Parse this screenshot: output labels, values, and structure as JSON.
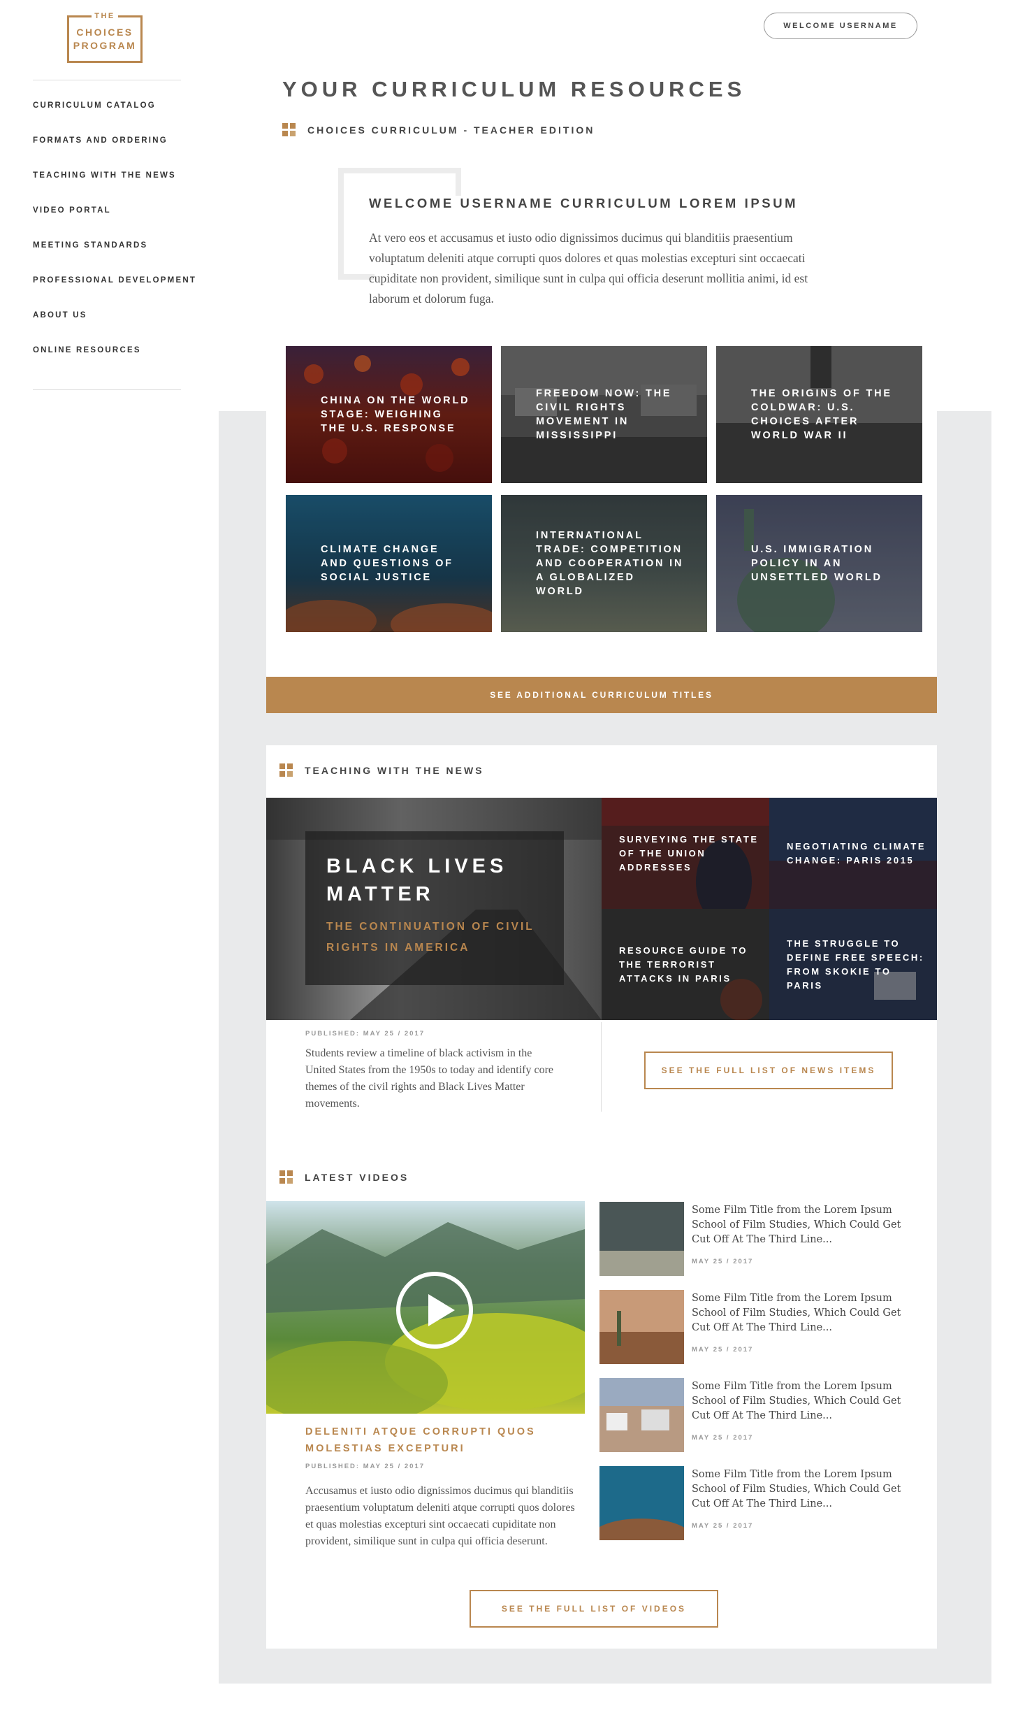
{
  "logo": {
    "line1": "THE",
    "line2": "CHOICES",
    "line3": "PROGRAM"
  },
  "header": {
    "welcome_button": "WELCOME USERNAME"
  },
  "sidebar": {
    "items": [
      {
        "label": "CURRICULUM CATALOG"
      },
      {
        "label": "FORMATS AND ORDERING"
      },
      {
        "label": "TEACHING WITH THE NEWS"
      },
      {
        "label": "VIDEO PORTAL"
      },
      {
        "label": "MEETING STANDARDS"
      },
      {
        "label": "PROFESSIONAL DEVELOPMENT"
      },
      {
        "label": "ABOUT US"
      },
      {
        "label": "ONLINE RESOURCES"
      }
    ]
  },
  "main": {
    "title": "YOUR CURRICULUM RESOURCES",
    "section_label": "CHOICES CURRICULUM - TEACHER EDITION",
    "welcome_heading": "WELCOME USERNAME CURRICULUM LOREM IPSUM",
    "welcome_text": "At vero eos et accusamus et iusto odio dignissimos ducimus qui blanditiis praesentium voluptatum deleniti atque corrupti quos dolores et quas molestias excepturi sint occaecati cupiditate non provident, similique sunt in culpa qui officia deserunt mollitia animi, id est laborum et dolorum fuga.",
    "tiles": [
      {
        "label": "CHINA ON THE WORLD STAGE: WEIGHING THE U.S. RESPONSE"
      },
      {
        "label": "FREEDOM NOW: THE CIVIL RIGHTS MOVEMENT IN MISSISSIPPI"
      },
      {
        "label": "THE ORIGINS OF THE COLDWAR: U.S. CHOICES AFTER WORLD WAR II"
      },
      {
        "label": "CLIMATE CHANGE AND QUESTIONS OF SOCIAL JUSTICE"
      },
      {
        "label": "INTERNATIONAL TRADE: COMPETITION AND COOPERATION IN A GLOBALIZED WORLD"
      },
      {
        "label": "U.S. IMMIGRATION POLICY IN AN UNSETTLED WORLD"
      }
    ],
    "cta_label": "SEE ADDITIONAL CURRICULUM TITLES"
  },
  "news": {
    "section_label": "TEACHING WITH THE NEWS",
    "feature": {
      "title": "BLACK LIVES MATTER",
      "subtitle": "THE CONTINUATION OF CIVIL RIGHTS IN AMERICA",
      "published": "PUBLISHED: MAY 25 / 2017",
      "description": "Students review a timeline of black activism in the United States from the 1950s to today and identify core themes of the civil rights and Black Lives Matter movements."
    },
    "items": [
      {
        "label": "SURVEYING THE STATE OF THE UNION ADDRESSES"
      },
      {
        "label": "NEGOTIATING CLIMATE CHANGE: PARIS 2015"
      },
      {
        "label": "RESOURCE GUIDE TO THE TERRORIST ATTACKS IN PARIS"
      },
      {
        "label": "THE STRUGGLE TO DEFINE FREE SPEECH: FROM SKOKIE TO PARIS"
      }
    ],
    "button_label": "SEE THE FULL LIST OF NEWS ITEMS"
  },
  "videos": {
    "section_label": "LATEST VIDEOS",
    "feature": {
      "title": "DELENITI ATQUE CORRUPTI QUOS MOLESTIAS EXCEPTURI",
      "published": "PUBLISHED: MAY 25 / 2017",
      "description": "Accusamus et iusto odio dignissimos ducimus qui blanditiis praesentium voluptatum deleniti atque corrupti quos dolores et quas molestias excepturi sint occaecati cupiditate non provident, similique sunt in culpa qui officia deserunt."
    },
    "items": [
      {
        "title": "Some Film Title from the Lorem Ipsum School of Film Studies, Which Could Get Cut Off At The Third Line...",
        "date": "MAY 25 / 2017"
      },
      {
        "title": "Some Film Title from the Lorem Ipsum School of Film Studies, Which Could Get Cut Off At The Third Line...",
        "date": "MAY 25 / 2017"
      },
      {
        "title": "Some Film Title from the Lorem Ipsum School of Film Studies, Which Could Get Cut Off At The Third Line...",
        "date": "MAY 25 / 2017"
      },
      {
        "title": "Some Film Title from the Lorem Ipsum School of Film Studies, Which Could Get Cut Off At The Third Line...",
        "date": "MAY 25 / 2017"
      }
    ],
    "button_label": "SEE THE FULL LIST OF VIDEOS"
  },
  "colors": {
    "accent": "#b9874f",
    "background_panel": "#e9eaeb",
    "text": "#444444"
  }
}
